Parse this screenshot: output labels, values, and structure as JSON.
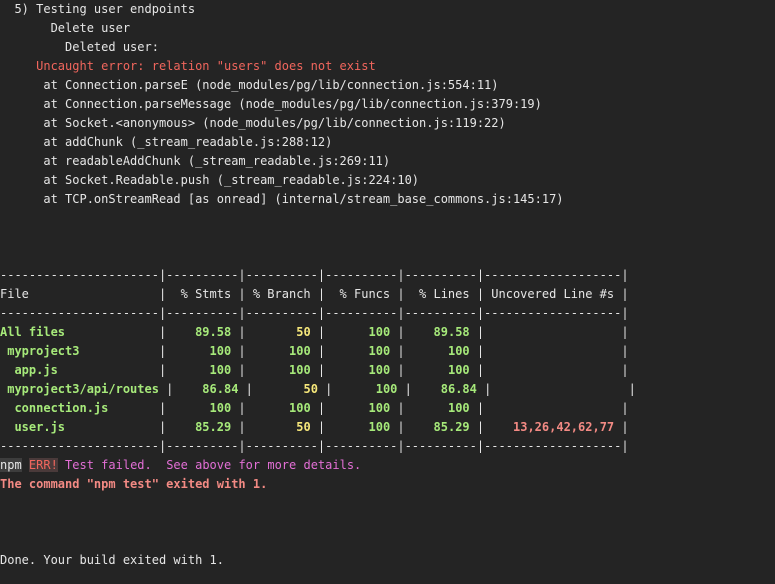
{
  "log": {
    "test_heading": "  5) Testing user endpoints",
    "describe": "       Delete user",
    "it": "         Deleted user:",
    "error": "     Uncaught error: relation \"users\" does not exist",
    "stack": [
      "      at Connection.parseE (node_modules/pg/lib/connection.js:554:11)",
      "      at Connection.parseMessage (node_modules/pg/lib/connection.js:379:19)",
      "      at Socket.<anonymous> (node_modules/pg/lib/connection.js:119:22)",
      "      at addChunk (_stream_readable.js:288:12)",
      "      at readableAddChunk (_stream_readable.js:269:11)",
      "      at Socket.Readable.push (_stream_readable.js:224:10)",
      "      at TCP.onStreamRead [as onread] (internal/stream_base_commons.js:145:17)"
    ]
  },
  "coverage": {
    "separator": "----------------------|----------|----------|----------|----------|-------------------|",
    "header": "File                  |  % Stmts | % Branch |  % Funcs |  % Lines | Uncovered Line #s |",
    "rows": [
      {
        "file": "All files",
        "stmts": "89.58",
        "branch": "50",
        "funcs": "100",
        "lines": "89.58",
        "uncovered": ""
      },
      {
        "file": "myproject3",
        "stmts": "100",
        "branch": "100",
        "funcs": "100",
        "lines": "100",
        "uncovered": ""
      },
      {
        "file": "app.js",
        "stmts": "100",
        "branch": "100",
        "funcs": "100",
        "lines": "100",
        "uncovered": ""
      },
      {
        "file": "myproject3/api/routes",
        "stmts": "86.84",
        "branch": "50",
        "funcs": "100",
        "lines": "86.84",
        "uncovered": ""
      },
      {
        "file": "connection.js",
        "stmts": "100",
        "branch": "100",
        "funcs": "100",
        "lines": "100",
        "uncovered": ""
      },
      {
        "file": "user.js",
        "stmts": "85.29",
        "branch": "50",
        "funcs": "100",
        "lines": "85.29",
        "uncovered": "13,26,42,62,77"
      }
    ],
    "indent": [
      0,
      1,
      2,
      1,
      2,
      2
    ],
    "row_colors": {
      "stmts": [
        "green",
        "green",
        "green",
        "green",
        "green",
        "green"
      ],
      "branch": [
        "yellow",
        "green",
        "green",
        "yellow",
        "green",
        "yellow"
      ],
      "funcs": [
        "green",
        "green",
        "green",
        "green",
        "green",
        "green"
      ],
      "lines": [
        "green",
        "green",
        "green",
        "green",
        "green",
        "green"
      ]
    }
  },
  "npm": {
    "npm_tag": "npm",
    "err_tag": "ERR!",
    "message": " Test failed.  See above for more details.",
    "command_failed": "The command \"npm test\" exited with 1."
  },
  "done": "Done. Your build exited with 1.",
  "colors": {
    "background": "#242424",
    "text": "#e6e6e6",
    "error_red": "#f1665d",
    "coverage_green": "#a6e97a",
    "coverage_yellow": "#f6e77a",
    "uncovered_salmon": "#f38a84",
    "npm_magenta": "#e36fd6"
  }
}
